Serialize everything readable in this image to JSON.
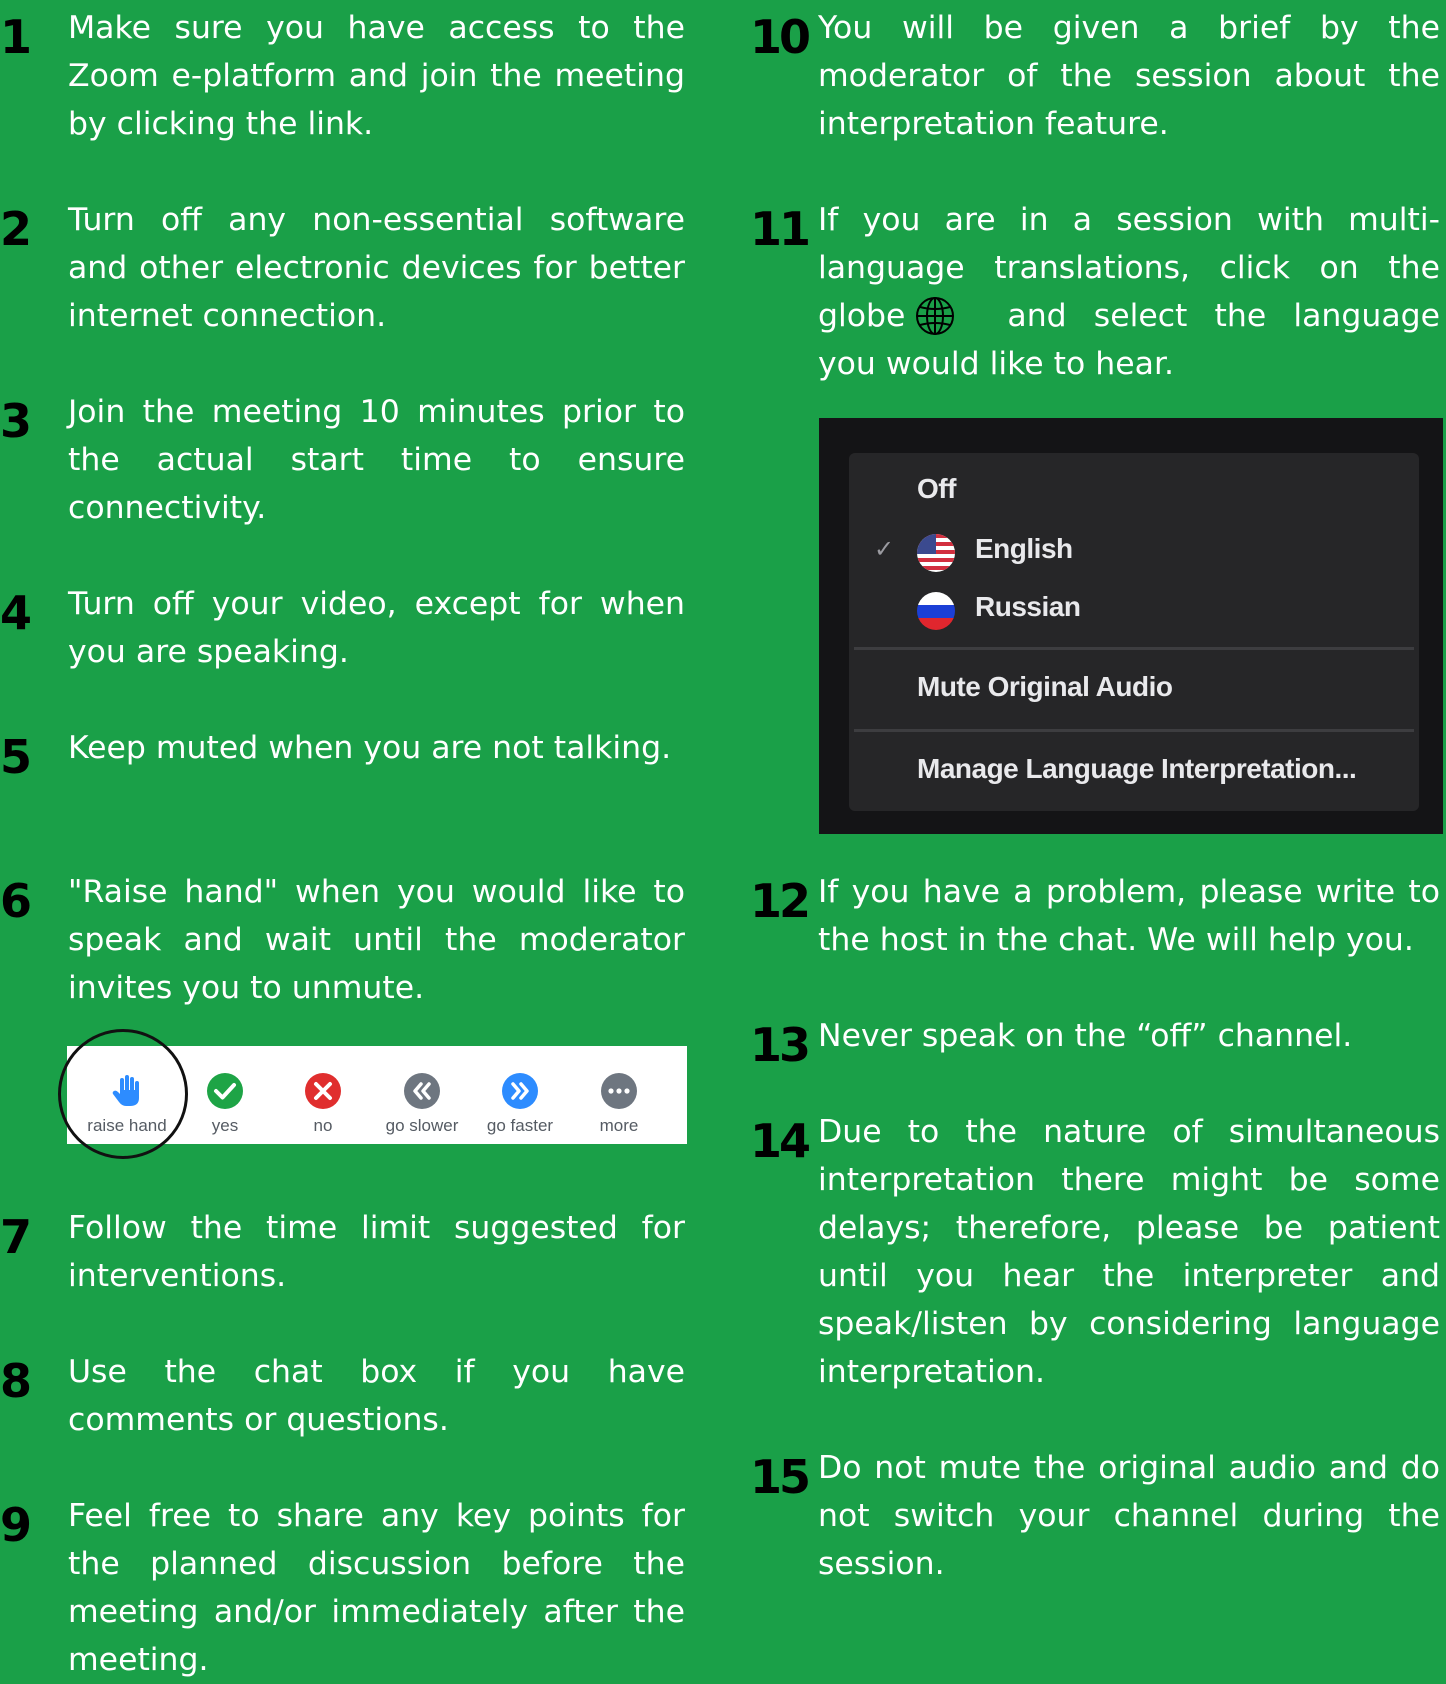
{
  "items": [
    {
      "num": "1",
      "text": "Make sure you have access to the Zoom e-platform and join the meeting by clicking the link."
    },
    {
      "num": "2",
      "text": "Turn off any non-essential software and other electronic devices for better internet connection."
    },
    {
      "num": "3",
      "text": "Join the meeting 10 minutes prior to the actual start time to ensure connectivity."
    },
    {
      "num": "4",
      "text": "Turn off your video, except for when you are speaking."
    },
    {
      "num": "5",
      "text": "Keep muted when you are not talking."
    },
    {
      "num": "6",
      "text": "\"Raise hand\" when you would like to speak and wait until the moderator invites you to unmute."
    },
    {
      "num": "7",
      "text": "Follow the time limit suggested for interventions."
    },
    {
      "num": "8",
      "text": "Use the chat box if you have comments or questions."
    },
    {
      "num": "9",
      "text": "Feel free to share any key points for the planned discussion before the meeting and/or immediately after the meeting."
    },
    {
      "num": "10",
      "text": "You will be given a brief by the moderator of the session about the interpretation feature."
    },
    {
      "num": "11",
      "text_before": "If you are in a session with multi-language translations, click on the globe",
      "text_after": "and select the language you would like to hear."
    },
    {
      "num": "12",
      "text": "If you have a problem, please write to the host in the chat. We will help you."
    },
    {
      "num": "13",
      "text": "Never speak on the “off” channel."
    },
    {
      "num": "14",
      "text": "Due to the nature of simultaneous interpretation there might be some delays; therefore, please be patient until you hear the interpreter and speak/listen by considering language interpretation."
    },
    {
      "num": "15",
      "text": "Do not mute the original audio and do not switch your channel during the session."
    }
  ],
  "reactions": {
    "raise_hand": "raise hand",
    "yes": "yes",
    "no": "no",
    "go_slower": "go slower",
    "go_faster": "go faster",
    "more": "more"
  },
  "language_menu": {
    "off": "Off",
    "english": "English",
    "russian": "Russian",
    "mute_original": "Mute Original Audio",
    "manage": "Manage Language Interpretation..."
  },
  "colors": {
    "background": "#1aa048",
    "number": "#000000",
    "text": "#ffffff",
    "raise_hand": "#2d8cff",
    "yes": "#1ea446",
    "no": "#e02e2e",
    "go_slower": "#6e7680",
    "go_faster": "#2d8cff",
    "more": "#6e7680"
  }
}
